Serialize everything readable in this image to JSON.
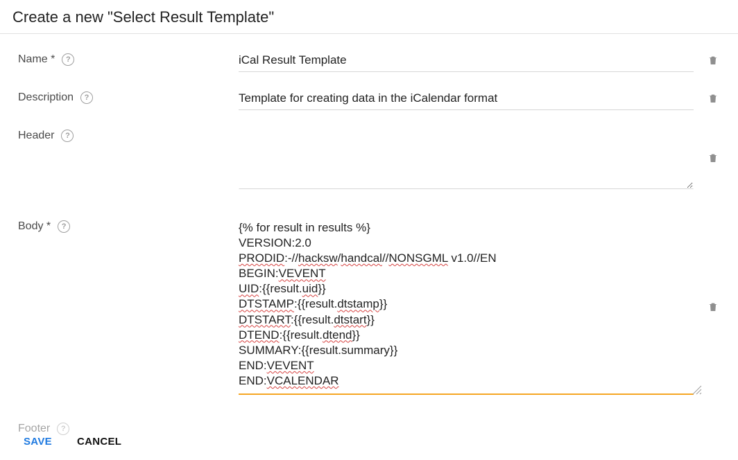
{
  "page_title": "Create a new \"Select Result Template\"",
  "fields": {
    "name": {
      "label": "Name *",
      "value": "iCal Result Template"
    },
    "description": {
      "label": "Description",
      "value": "Template for creating data in the iCalendar format"
    },
    "header": {
      "label": "Header",
      "value": ""
    },
    "body": {
      "label": "Body *",
      "lines": [
        {
          "segments": [
            {
              "t": "{% for result in "
            },
            {
              "t": "results",
              "u": false
            },
            {
              "t": " %}"
            }
          ]
        },
        {
          "segments": [
            {
              "t": "VERSION:2.0"
            }
          ]
        },
        {
          "segments": [
            {
              "t": "PRODID",
              "u": true
            },
            {
              "t": ":-//"
            },
            {
              "t": "hacksw",
              "u": true
            },
            {
              "t": "/"
            },
            {
              "t": "handcal",
              "u": true
            },
            {
              "t": "//"
            },
            {
              "t": "NONSGML",
              "u": true
            },
            {
              "t": " v1.0//EN"
            }
          ]
        },
        {
          "segments": [
            {
              "t": "BEGIN:"
            },
            {
              "t": "VEVENT",
              "u": true
            }
          ]
        },
        {
          "segments": [
            {
              "t": "UID",
              "u": true
            },
            {
              "t": ":{{result."
            },
            {
              "t": "uid",
              "u": true
            },
            {
              "t": "}}"
            }
          ]
        },
        {
          "segments": [
            {
              "t": "DTSTAMP",
              "u": true
            },
            {
              "t": ":{{result."
            },
            {
              "t": "dtstamp",
              "u": true
            },
            {
              "t": "}}"
            }
          ]
        },
        {
          "segments": [
            {
              "t": "DTSTART",
              "u": true
            },
            {
              "t": ":{{result."
            },
            {
              "t": "dtstart",
              "u": true
            },
            {
              "t": "}}"
            }
          ]
        },
        {
          "segments": [
            {
              "t": "DTEND",
              "u": true
            },
            {
              "t": ":{{result."
            },
            {
              "t": "dtend",
              "u": true
            },
            {
              "t": "}}"
            }
          ]
        },
        {
          "segments": [
            {
              "t": "SUMMARY:{{result.summary}}"
            }
          ]
        },
        {
          "segments": [
            {
              "t": "END:"
            },
            {
              "t": "VEVENT",
              "u": true
            }
          ]
        },
        {
          "segments": [
            {
              "t": "END:"
            },
            {
              "t": "VCALENDAR",
              "u": true
            }
          ]
        }
      ]
    },
    "footer": {
      "label": "Footer",
      "value": ""
    }
  },
  "actions": {
    "save": "SAVE",
    "cancel": "CANCEL"
  },
  "icons": {
    "help": "?",
    "trash": "trash"
  }
}
